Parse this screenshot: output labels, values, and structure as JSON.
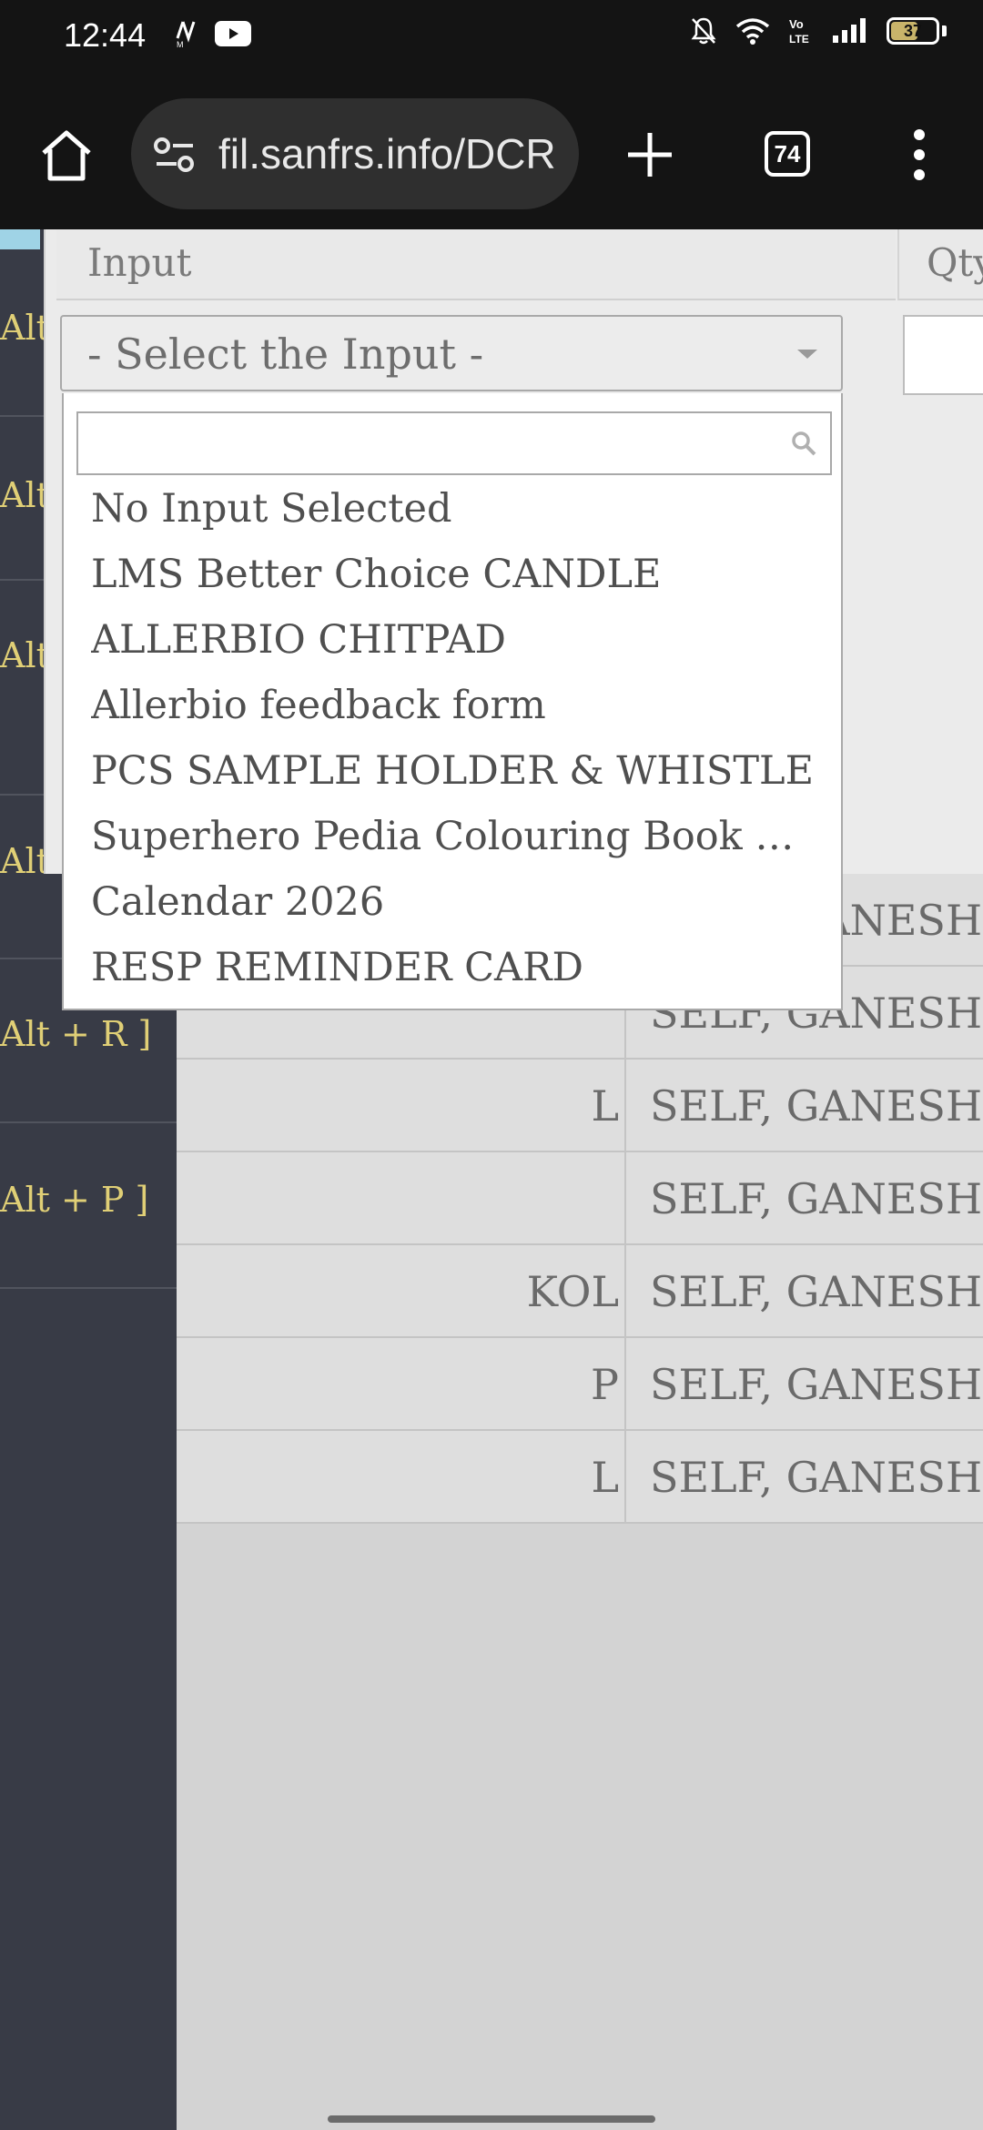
{
  "status_bar": {
    "time": "12:44",
    "battery": "37",
    "icons": [
      "news-icon",
      "youtube-icon",
      "mute-bell-icon",
      "wifi-icon",
      "volte-icon",
      "signal-icon",
      "battery-icon"
    ]
  },
  "browser": {
    "url": "fil.sanfrs.info/DCR",
    "tab_count": "74"
  },
  "sidebar": {
    "items": [
      "Alt",
      "Alt",
      "Alt",
      "Alt +",
      "Alt + R ]",
      "Alt + P ]"
    ]
  },
  "form": {
    "columns": {
      "input": "Input",
      "qty": "Qty"
    },
    "select_placeholder": "- Select the Input -",
    "search_value": "",
    "options": [
      "No Input Selected",
      "LMS Better Choice CANDLE",
      "ALLERBIO CHITPAD",
      "Allerbio feedback form",
      "PCS SAMPLE HOLDER & WHISTLE",
      "Superhero Pedia Colouring Book & cr...",
      "Calendar 2026",
      "RESP REMINDER CARD"
    ]
  },
  "table": {
    "rows": [
      {
        "a": "",
        "b": "SELF, GANESH V"
      },
      {
        "a": "",
        "b": "SELF, GANESH V"
      },
      {
        "a": "L",
        "b": "SELF, GANESH V"
      },
      {
        "a": "",
        "b": "SELF, GANESH V"
      },
      {
        "a": "KOL",
        "b": "SELF, GANESH V"
      },
      {
        "a": "P",
        "b": "SELF, GANESH V"
      },
      {
        "a": "L",
        "b": "SELF, GANESH V"
      }
    ]
  }
}
